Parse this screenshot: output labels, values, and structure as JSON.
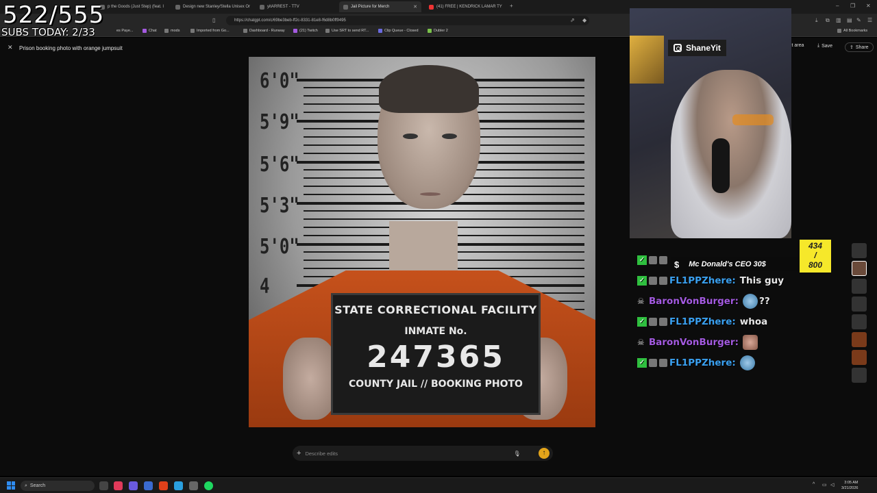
{
  "stream_overlay": {
    "sub_count": "522/555",
    "subs_today": "SUBS TODAY: 2/33",
    "instagram_handle": "ShaneYit",
    "goal_current": "434",
    "goal_slash": "/",
    "goal_total": "800"
  },
  "browser": {
    "tabs": [
      {
        "label": "p the Goods (Just Step) (feat. I"
      },
      {
        "label": "Design new Stanley/Stella Unisex Or"
      },
      {
        "label": "yitARREST - TTV"
      },
      {
        "label": "Jail Picture for Merch",
        "active": true
      },
      {
        "label": "(41) FREE | KENDRICK LAMAR TY"
      }
    ],
    "url": "https://chatgpt.com/c/69be3beb-ff2c-8331-81e8-f6d8b0ff9495",
    "bookmarks": [
      "es Paye...",
      "Chat",
      "mods",
      "Imported from Go...",
      "Dashboard - Runway",
      "(21) Twitch",
      "Use SRT to send RT...",
      "Clip Queue - Closed",
      "Dubler 2"
    ],
    "all_bookmarks": "All Bookmarks"
  },
  "page": {
    "title": "Prison booking photo with orange jumpsuit",
    "select_area": "ct area",
    "save": "Save",
    "share": "Share",
    "edit_placeholder": "Describe edits"
  },
  "mugshot": {
    "height_marks": [
      "6'0\"",
      "5'9\"",
      "5'6\"",
      "5'3\"",
      "5'0\"",
      "4"
    ],
    "board_line1": "STATE CORRECTIONAL FACILITY",
    "board_line2": "INMATE No.",
    "board_number": "247365",
    "board_line4": "COUNTY JAIL // BOOKING PHOTO"
  },
  "chat": {
    "donation": {
      "dollar": "$",
      "text": "Mc Donald's CEO 30$"
    },
    "messages": [
      {
        "user": "FL1PPZhere:",
        "text": "This guy",
        "color": "blue"
      },
      {
        "user": "BaronVonBurger:",
        "text": "??",
        "color": "purple"
      },
      {
        "user": "FL1PPZhere:",
        "text": "whoa",
        "color": "blue"
      },
      {
        "user": "BaronVonBurger:",
        "text": "",
        "color": "purple"
      },
      {
        "user": "FL1PPZhere:",
        "text": "",
        "color": "blue"
      }
    ]
  },
  "taskbar": {
    "search": "Search",
    "time": "3:05 AM",
    "date": "3/21/2026"
  },
  "colors": {
    "accent_send": "#e3a41a",
    "chat_blue": "#3aa0f0",
    "chat_purple": "#a35ae0",
    "goal_yellow": "#f6e82a",
    "jumpsuit": "#c8521c"
  }
}
